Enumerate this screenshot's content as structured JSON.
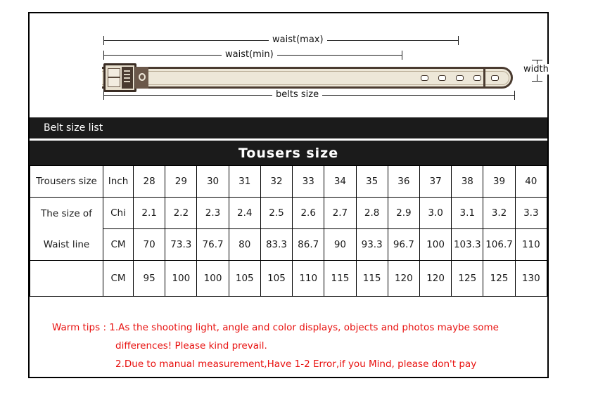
{
  "diagram": {
    "labels": {
      "waist_max": "waist(max)",
      "waist_min": "waist(min)",
      "belts_size": "belts size",
      "width": "width"
    }
  },
  "bars": {
    "belt_size_list": "Belt size list",
    "title": "Tousers  size"
  },
  "table": {
    "row_labels": {
      "trousers_size": "Trousers size",
      "size_of": "The size of",
      "waist_line": "Waist line",
      "empty": ""
    },
    "units": {
      "inch": "Inch",
      "chi": "Chi",
      "cm": "CM",
      "cm2": "CM"
    },
    "inch": [
      "28",
      "29",
      "30",
      "31",
      "32",
      "33",
      "34",
      "35",
      "36",
      "37",
      "38",
      "39",
      "40"
    ],
    "chi": [
      "2.1",
      "2.2",
      "2.3",
      "2.4",
      "2.5",
      "2.6",
      "2.7",
      "2.8",
      "2.9",
      "3.0",
      "3.1",
      "3.2",
      "3.3"
    ],
    "cm": [
      "70",
      "73.3",
      "76.7",
      "80",
      "83.3",
      "86.7",
      "90",
      "93.3",
      "96.7",
      "100",
      "103.3",
      "106.7",
      "110"
    ],
    "belt_cm": [
      "95",
      "100",
      "100",
      "105",
      "105",
      "110",
      "115",
      "115",
      "120",
      "120",
      "125",
      "125",
      "130"
    ]
  },
  "tips": {
    "line1": "Warm tips : 1.As the shooting light, angle and color displays, objects and photos maybe some",
    "line2": "differences! Please kind prevail.",
    "line3": "2.Due to manual measurement,Have 1-2 Error,if you Mind, please  don't pay"
  },
  "colors": {
    "bar_bg": "#1b1b1b",
    "tip_text": "#e8110f",
    "belt_leather": "#ede7d8",
    "belt_edge": "#4a3b30"
  }
}
